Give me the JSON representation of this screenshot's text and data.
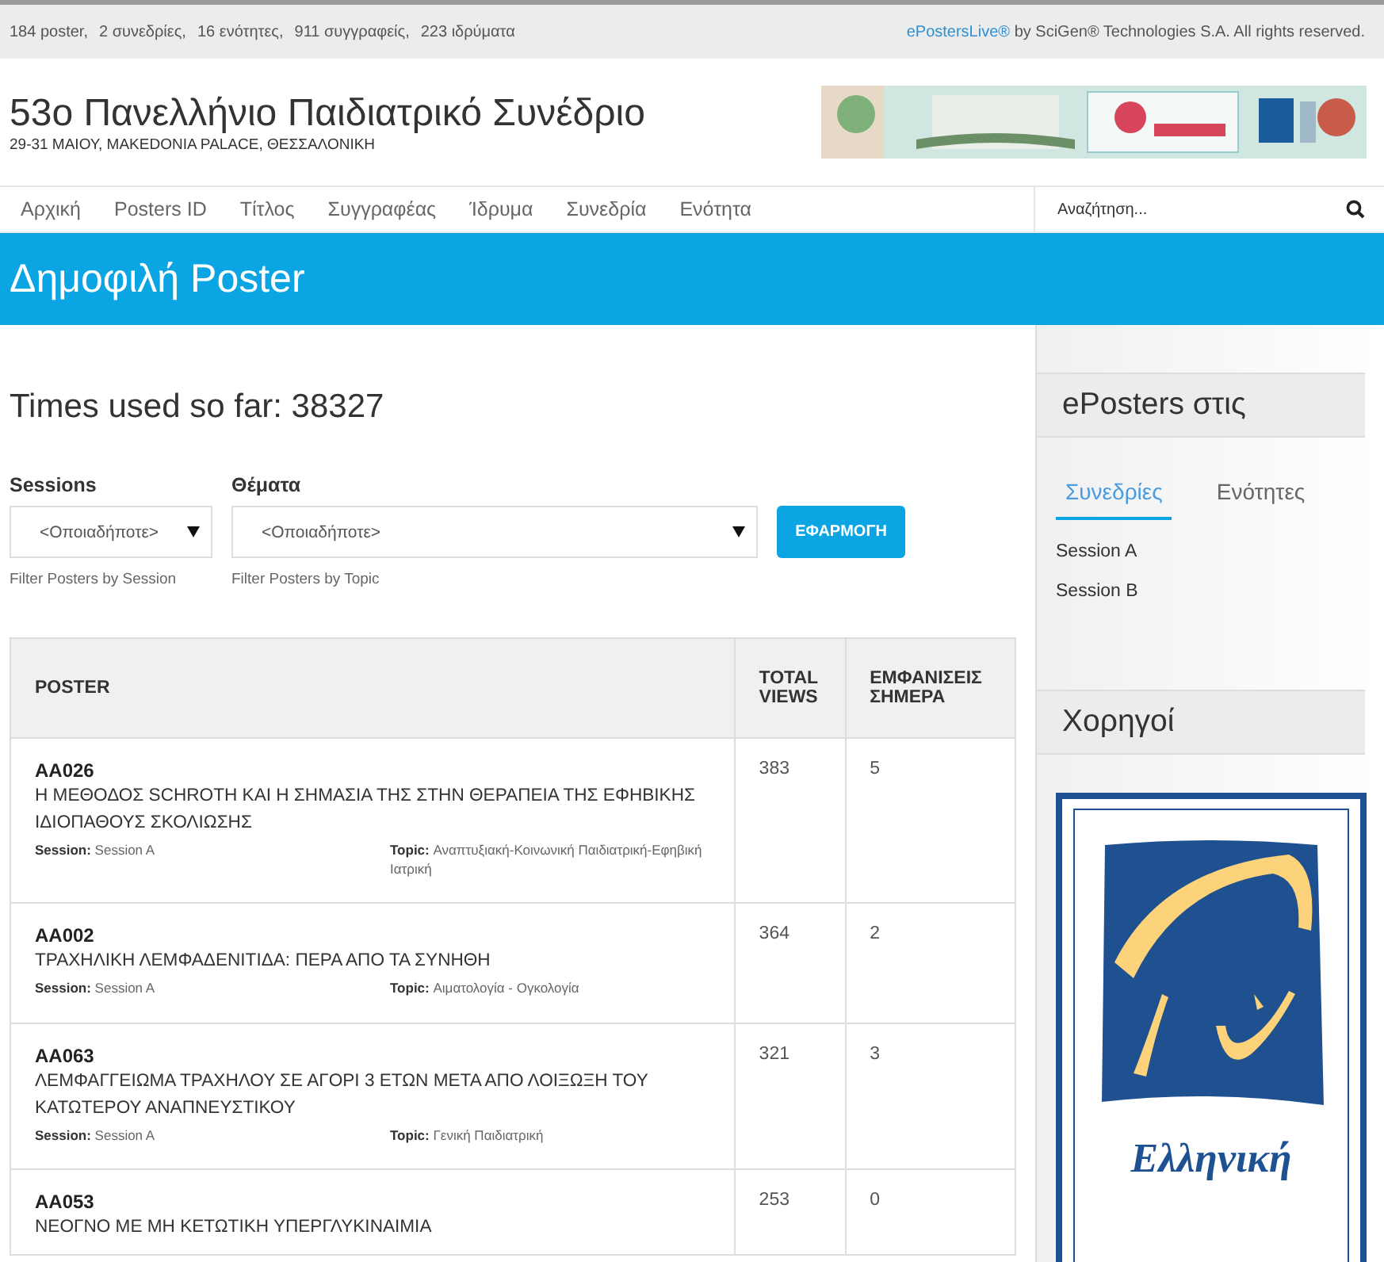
{
  "top_bar": {
    "stats": [
      "184 poster,",
      "2 συνεδρίες,",
      "16 ενότητες,",
      "911 συγγραφείς,",
      "223 ιδρύματα"
    ],
    "brand_link": "ePostersLive®",
    "credit": "by SciGen® Technologies S.A. All rights reserved."
  },
  "header": {
    "title": "53ο Πανελλήνιο Παιδιατρικό Συνέδριο",
    "subtitle": "29-31 ΜΑΙΟΥ, MAKEDONIA PALACE, ΘΕΣΣΑΛΟΝΙΚΗ"
  },
  "nav": {
    "items": [
      {
        "label": "Αρχική"
      },
      {
        "label": "Posters ID"
      },
      {
        "label": "Τίτλος"
      },
      {
        "label": "Συγγραφέας"
      },
      {
        "label": "Ίδρυμα"
      },
      {
        "label": "Συνεδρία"
      },
      {
        "label": "Ενότητα"
      }
    ],
    "search": {
      "placeholder": "Αναζήτηση..."
    }
  },
  "band": {
    "title": "Δημοφιλή Poster"
  },
  "usage": "Times used so far: 38327",
  "filters": [
    {
      "label": "Sessions",
      "value": "<Οποιαδήποτε>",
      "hint": "Filter Posters by Session"
    },
    {
      "label": "Θέματα",
      "value": "<Οποιαδήποτε>",
      "hint": "Filter Posters by Topic"
    }
  ],
  "apply_button": "ΕΦΑΡΜΟΓΗ",
  "table": {
    "columns": [
      "POSTER",
      "TOTAL VIEWS",
      "ΕΜΦΑΝΙΣΕΙΣ ΣΗΜΕΡΑ"
    ],
    "rows": [
      {
        "code": "AA026",
        "title": "Η ΜΕΘΟΔΟΣ SCHROTH ΚΑΙ Η ΣΗΜΑΣΙΑ ΤΗΣ ΣΤΗΝ ΘΕΡΑΠΕΙΑ ΤΗΣ ΕΦΗΒΙΚΗΣ ΙΔΙΟΠΑΘΟΥΣ ΣΚΟΛΙΩΣΗΣ",
        "session": "**Session:** Session A",
        "topic": "**Topic:** Αναπτυξιακή-Κοινωνική Παιδιατρική-Εφηβική Ιατρική",
        "total": "383",
        "today": "5"
      },
      {
        "code": "AA002",
        "title": "ΤΡΑΧΗΛΙΚΗ ΛΕΜΦΑΔΕΝΙΤΙΔΑ: ΠΕΡΑ ΑΠΟ ΤΑ ΣΥΝΗΘΗ",
        "session": "**Session:** Session A",
        "topic": "**Topic:** Αιματολογία - Ογκολογία",
        "total": "364",
        "today": "2"
      },
      {
        "code": "AA063",
        "title": "ΛΕΜΦΑΓΓΕΙΩΜΑ ΤΡΑΧΗΛΟΥ ΣΕ ΑΓΟΡΙ 3 ΕΤΩΝ ΜΕΤΑ ΑΠΟ ΛΟΙΞΩΞΗ ΤΟΥ ΚΑΤΩΤΕΡΟΥ ΑΝΑΠΝΕΥΣΤΙΚΟΥ",
        "session": "**Session:** Session A",
        "topic": "**Topic:** Γενική Παιδιατρική",
        "total": "321",
        "today": "3"
      },
      {
        "code": "AA053",
        "title": "ΝΕΟΓΝΟ ΜΕ ΜΗ ΚΕΤΩΤΙΚΗ ΥΠΕΡΓΛΥΚΙΝΑΙΜΙΑ",
        "total": "253",
        "today": "0"
      }
    ]
  },
  "sidebar": {
    "panel_title": "ePosters στις",
    "tabs": [
      {
        "label": "Συνεδρίες",
        "selected": true
      },
      {
        "label": "Ενότητες",
        "selected": false
      }
    ],
    "items": [
      "Session A",
      "Session B"
    ],
    "sponsors_title": "Χορηγοί",
    "sponsor_logo_text": "Ελληνική"
  }
}
